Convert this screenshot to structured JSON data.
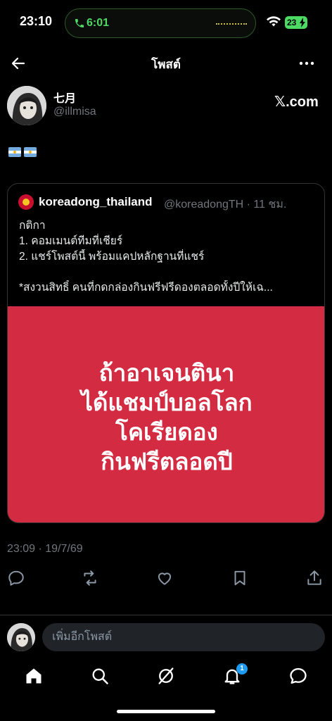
{
  "status_bar": {
    "time": "23:10",
    "call_time": "6:01",
    "battery": "23"
  },
  "header": {
    "title": "โพสต์"
  },
  "post": {
    "author_name": "七月",
    "author_handle": "@illmisa",
    "source_label": "𝕏.com",
    "body_icons": [
      "argentina-flag-icon",
      "argentina-flag-icon"
    ],
    "timestamp": "23:09 · 19/7/69"
  },
  "quoted": {
    "name": "koreadong_thailand",
    "meta": "@koreadongTH · 11 ชม.",
    "lines": [
      "กติกา",
      "1. คอมเมนต์ทีมที่เชียร์",
      "2. แชร์โพสต์นี้ พร้อมแคปหลักฐานที่แชร์",
      "",
      "*สงวนสิทธิ์ คนที่กดกล่องกินฟรีฟรีดองตลอดทั้งปีให้เฉ..."
    ],
    "image_text": [
      "ถ้าอาเจนตินา",
      "ได้แชมป์บอลโลก",
      "โคเรียดอง",
      "กินฟรีตลอดปี"
    ],
    "image_bg": "#d22b42"
  },
  "reply": {
    "placeholder": "เพิ่มอีกโพสต์"
  },
  "tabs": {
    "notification_count": "1"
  },
  "colors": {
    "background": "#000000",
    "accent": "#1d9bf0",
    "secondary_text": "#71767b"
  }
}
